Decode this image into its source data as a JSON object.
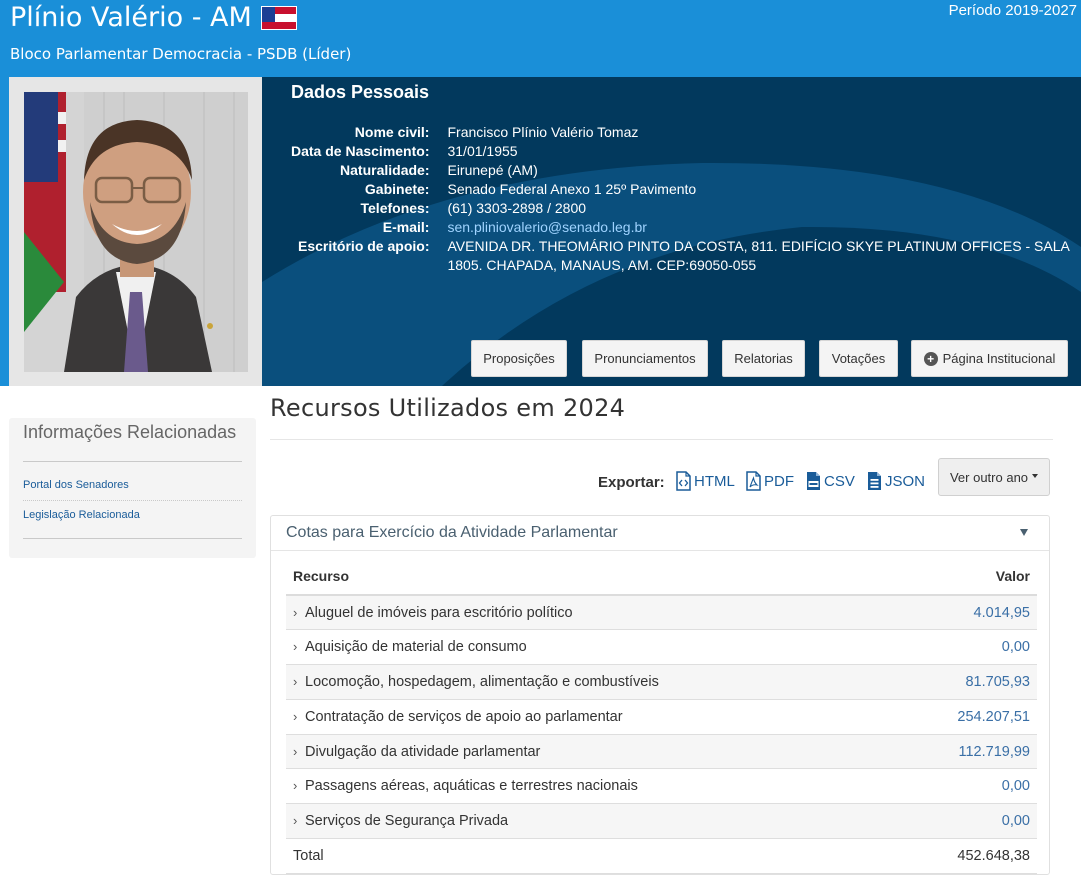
{
  "header": {
    "name": "Plínio Valério - AM",
    "period": "Período 2019-2027",
    "bloc": "Bloco Parlamentar Democracia - PSDB (Líder)"
  },
  "personal": {
    "title": "Dados Pessoais",
    "rows": [
      {
        "label": "Nome civil:",
        "value": "Francisco Plínio Valério Tomaz"
      },
      {
        "label": "Data de Nascimento:",
        "value": "31/01/1955"
      },
      {
        "label": "Naturalidade:",
        "value": "Eirunepé (AM)"
      },
      {
        "label": "Gabinete:",
        "value": "Senado Federal Anexo 1 25º Pavimento"
      },
      {
        "label": "Telefones:",
        "value": "(61) 3303-2898 / 2800"
      },
      {
        "label": "E-mail:",
        "value": "sen.pliniovalerio@senado.leg.br"
      },
      {
        "label": "Escritório de apoio:",
        "value": "AVENIDA DR. THEOMÁRIO PINTO DA COSTA, 811. EDIFÍCIO SKYE PLATINUM OFFICES - SALA 1805. CHAPADA, MANAUS, AM. CEP:69050-055"
      }
    ]
  },
  "actions": {
    "proposicoes": "Proposições",
    "pronunciamentos": "Pronunciamentos",
    "relatorias": "Relatorias",
    "votacoes": "Votações",
    "pagina": "Página Institucional",
    "plus": "+"
  },
  "sidebar": {
    "title": "Informações Relacionadas",
    "links": [
      "Portal dos Senadores",
      "Legislação Relacionada"
    ]
  },
  "main": {
    "title": "Recursos Utilizados em 2024",
    "export_label": "Exportar:",
    "exports": [
      "HTML",
      "PDF",
      "CSV",
      "JSON"
    ],
    "ver_outro_ano": "Ver outro ano"
  },
  "panel": {
    "title": "Cotas para Exercício da Atividade Parlamentar",
    "col_recurso": "Recurso",
    "col_valor": "Valor",
    "rows": [
      {
        "label": "Aluguel de imóveis para escritório político",
        "value": "4.014,95"
      },
      {
        "label": "Aquisição de material de consumo",
        "value": "0,00"
      },
      {
        "label": "Locomoção, hospedagem, alimentação e combustíveis",
        "value": "81.705,93"
      },
      {
        "label": "Contratação de serviços de apoio ao parlamentar",
        "value": "254.207,51"
      },
      {
        "label": "Divulgação da atividade parlamentar",
        "value": "112.719,99"
      },
      {
        "label": "Passagens aéreas, aquáticas e terrestres nacionais",
        "value": "0,00"
      },
      {
        "label": "Serviços de Segurança Privada",
        "value": "0,00"
      }
    ],
    "total_label": "Total",
    "total_value": "452.648,38",
    "chevron": "›"
  },
  "icons": {
    "flag": "amazonas-flag-icon",
    "html": "file-code-icon",
    "pdf": "file-pdf-icon",
    "csv": "file-csv-icon",
    "json": "file-json-icon",
    "dropdown": "caret-down-icon",
    "collapse": "triangle-down-icon"
  },
  "colors": {
    "header_blue": "#1a8fd8",
    "panel_navy": "#02395d",
    "link_blue": "#1a5c99",
    "value_blue": "#3a6fa6"
  }
}
